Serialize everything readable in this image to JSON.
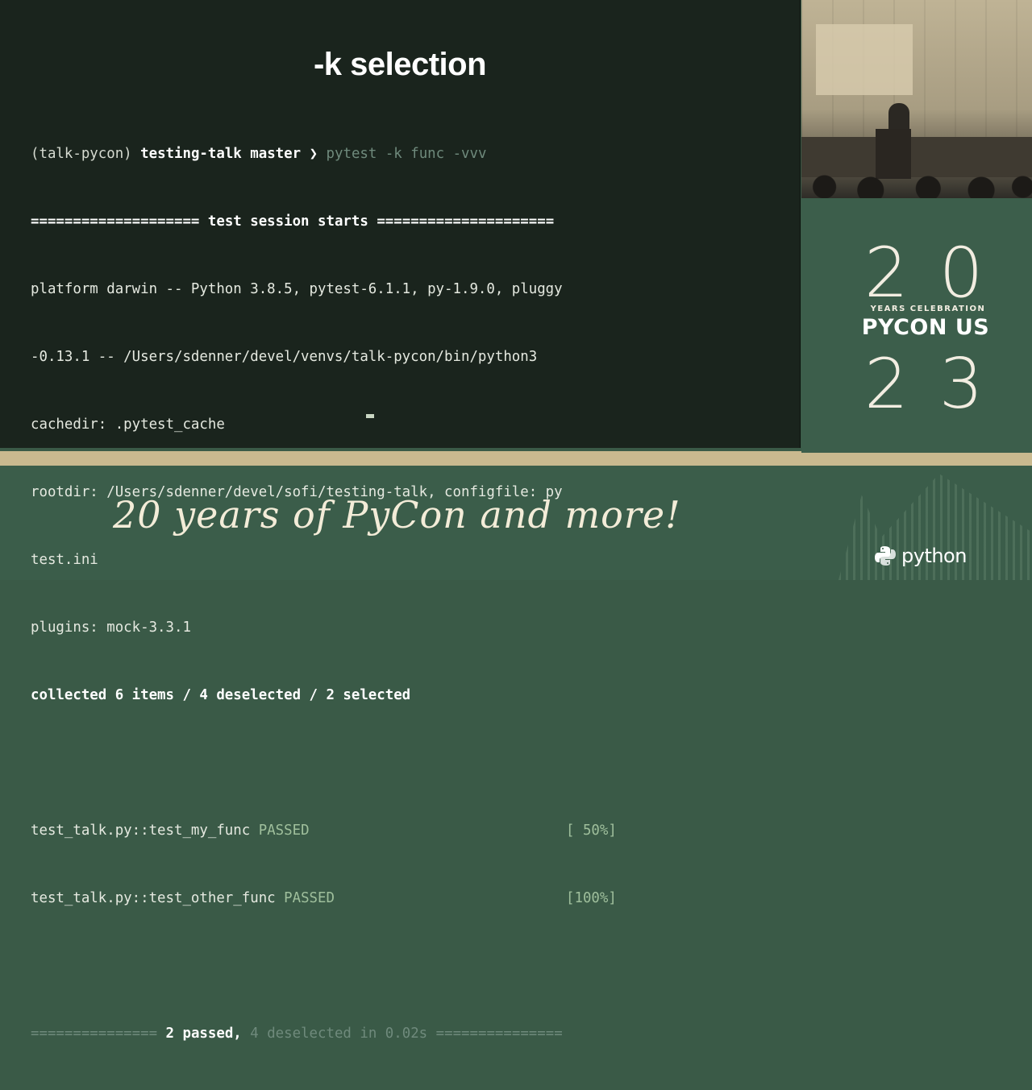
{
  "slide": {
    "title": "-k selection",
    "prompt": {
      "env": "(talk-pycon)",
      "dir": "testing-talk",
      "branch": "master",
      "arrow": "❯",
      "command": "pytest -k func -vvv"
    },
    "lines": {
      "session_left": "====================",
      "session_text": "test session starts",
      "session_right": "=====================",
      "platform_1": "platform darwin -- Python 3.8.5, pytest-6.1.1, py-1.9.0, pluggy",
      "platform_2": "-0.13.1 -- /Users/sdenner/devel/venvs/talk-pycon/bin/python3",
      "cachedir": "cachedir: .pytest_cache",
      "rootdir_1": "rootdir: /Users/sdenner/devel/sofi/testing-talk, configfile: py",
      "rootdir_2": "test.ini",
      "plugins": "plugins: mock-3.3.1",
      "collected": "collected 6 items / 4 deselected / 2 selected",
      "result_1_name": "test_talk.py::test_my_func",
      "result_1_status": "PASSED",
      "result_1_pct": "[ 50%]",
      "result_2_name": "test_talk.py::test_other_func",
      "result_2_status": "PASSED",
      "result_2_pct": "[100%]",
      "summary_left": "===============",
      "summary_passed": "2 passed,",
      "summary_rest": "4 deselected in 0.02s",
      "summary_right": "==============="
    }
  },
  "badge": {
    "top_digits": "20",
    "celebration": "YEARS CELEBRATION",
    "name": "PYCON US",
    "bottom_digits": "23"
  },
  "footer": {
    "tagline": "20 years of PyCon and more!",
    "python_logo_text": "python"
  },
  "colors": {
    "slide_bg": "#1a241d",
    "panel_green": "#3c5e4b",
    "cream": "#c9b98f"
  }
}
